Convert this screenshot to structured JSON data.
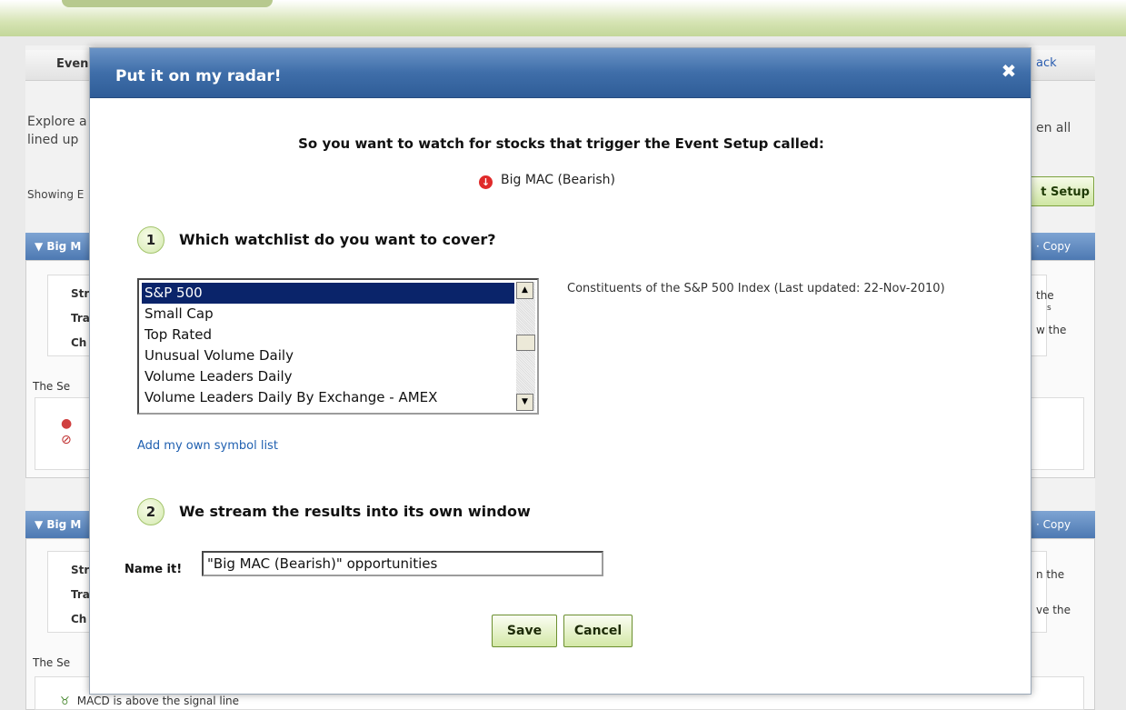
{
  "background": {
    "tab_label": "Even",
    "back_link": "ack",
    "explore_line1": "Explore a",
    "explore_line2": "lined up",
    "right_text": "en all",
    "showing_text": "Showing E",
    "setup_button": "t Setup",
    "panel1": {
      "label": "Big M",
      "copy": "· Copy",
      "lines": [
        "Str",
        "Tra",
        "Ch"
      ],
      "right_lines": [
        "the",
        "s",
        "w the"
      ],
      "sub_label": "The Se"
    },
    "panel2": {
      "label": "Big M",
      "copy": "· Copy",
      "lines": [
        "Str",
        "Tra",
        "Ch"
      ],
      "right_lines": [
        "n the",
        "ve the"
      ],
      "sub_label": "The Se"
    },
    "macd_text": "MACD is above the signal line"
  },
  "modal": {
    "title": "Put it on my radar!",
    "close_symbol": "✖",
    "heading": "So you want to watch for stocks that trigger the Event Setup called:",
    "setup_name": "Big MAC (Bearish)",
    "step1": {
      "number": "1",
      "text": "Which watchlist do you want to cover?"
    },
    "watchlist": {
      "items": [
        "S&P 500",
        "Small Cap",
        "Top Rated",
        "Unusual Volume Daily",
        "Volume Leaders Daily",
        "Volume Leaders Daily By Exchange - AMEX"
      ],
      "selected": "S&P 500"
    },
    "watchlist_description": "Constituents of the S&P 500 Index (Last updated: 22-Nov-2010)",
    "add_list_link": "Add my own symbol list",
    "step2": {
      "number": "2",
      "text": "We stream the results into its own window"
    },
    "name_label": "Name it!",
    "name_value": "\"Big MAC (Bearish)\" opportunities",
    "save_label": "Save",
    "cancel_label": "Cancel"
  }
}
